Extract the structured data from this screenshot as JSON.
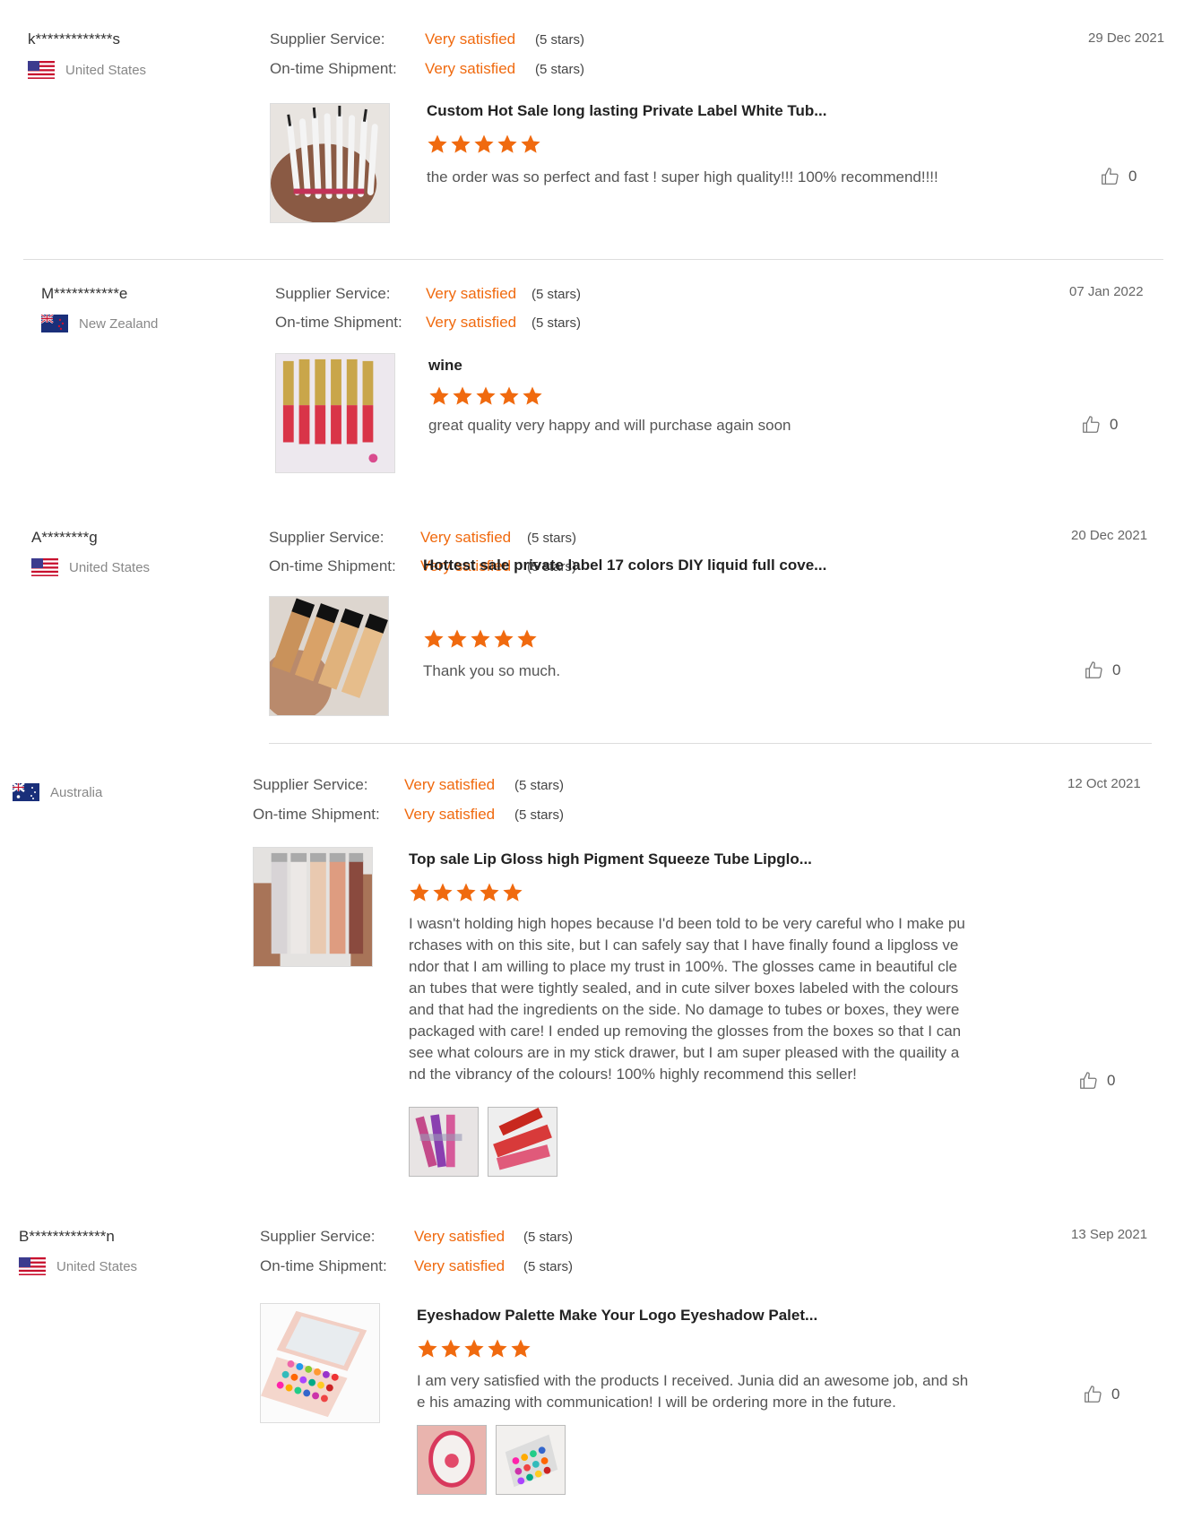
{
  "labels": {
    "supplier_service": "Supplier Service:",
    "ontime_shipment": "On-time Shipment:"
  },
  "colors": {
    "accent": "#f06a0f",
    "star": "#f06a0f"
  },
  "reviews": [
    {
      "user": "k*************s",
      "country": "United States",
      "flag": "us-flag-icon",
      "supplier_value": "Very satisfied",
      "supplier_stars": "(5 stars)",
      "shipment_value": "Very satisfied",
      "shipment_stars": "(5 stars)",
      "date": "29 Dec 2021",
      "product": "Custom Hot Sale long lasting Private Label White Tub...",
      "rating": 5,
      "comment": "the order was so perfect and fast ! super high quality!!! 100% recommend!!!!",
      "likes": "0"
    },
    {
      "user": "M***********e",
      "country": "New Zealand",
      "flag": "nz-flag-icon",
      "supplier_value": "Very satisfied",
      "supplier_stars": "(5 stars)",
      "shipment_value": "Very satisfied",
      "shipment_stars": "(5 stars)",
      "date": "07 Jan 2022",
      "product": "wine",
      "rating": 5,
      "comment": "great quality very happy and will purchase again soon",
      "likes": "0"
    },
    {
      "user": "A********g",
      "country": "United States",
      "flag": "us-flag-icon",
      "supplier_value": "Very satisfied",
      "supplier_stars": "(5 stars)",
      "shipment_value": "Very satisfied",
      "shipment_stars": "(5 stars)",
      "date": "20 Dec 2021",
      "product": "Hottest sale private label 17 colors DIY liquid full cove...",
      "rating": 5,
      "comment": "Thank you so much.",
      "likes": "0"
    },
    {
      "user": "",
      "country": "Australia",
      "flag": "au-flag-icon",
      "supplier_value": "Very satisfied",
      "supplier_stars": "(5 stars)",
      "shipment_value": "Very satisfied",
      "shipment_stars": "(5 stars)",
      "date": "12 Oct 2021",
      "product": "Top sale Lip Gloss high Pigment Squeeze Tube Lipglo...",
      "rating": 5,
      "comment_lines": [
        "I wasn't holding high hopes because I'd been told to be very careful who I make pu",
        "rchases with on this site, but I can safely say that I have finally found a lipgloss ve",
        "ndor that I am willing to place my trust in 100%. The glosses came in beautiful cle",
        "an tubes that were tightly sealed, and in cute silver boxes labeled with the colours",
        "and that had the ingredients on the side. No damage to tubes or boxes, they were",
        "packaged with care! I ended up removing the glosses from the boxes so that I can",
        "see what colours are in my stick drawer, but I am super pleased with the quaility a",
        "nd the vibrancy of the colours! 100% highly recommend this seller!"
      ],
      "likes": "0"
    },
    {
      "user": "B*************n",
      "country": "United States",
      "flag": "us-flag-icon",
      "supplier_value": "Very satisfied",
      "supplier_stars": "(5 stars)",
      "shipment_value": "Very satisfied",
      "shipment_stars": "(5 stars)",
      "date": "13 Sep 2021",
      "product": "Eyeshadow Palette Make Your Logo Eyeshadow Palet...",
      "rating": 5,
      "comment_lines": [
        "I am very satisfied with the products I received. Junia did an awesome job, and sh",
        "e his amazing with communication! I will be ordering more in the future."
      ],
      "likes": "0"
    }
  ]
}
